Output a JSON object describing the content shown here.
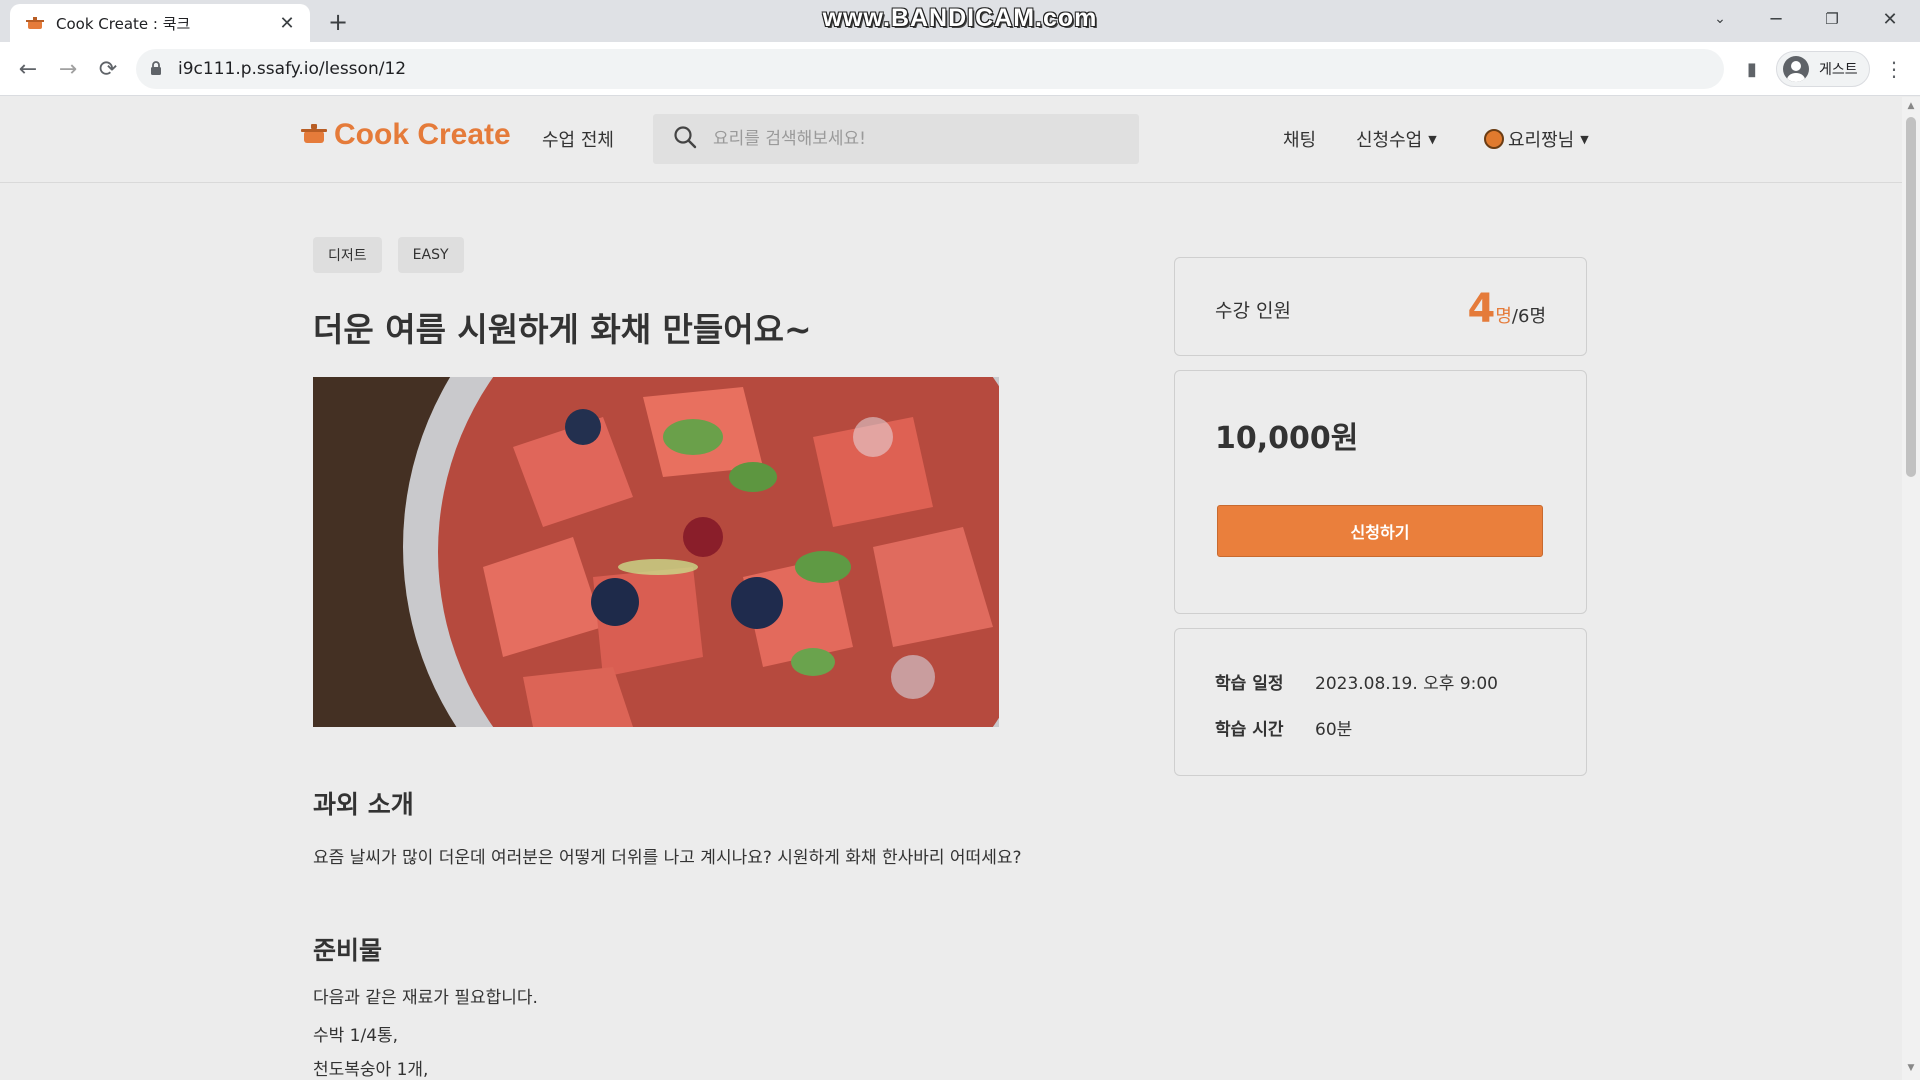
{
  "browser": {
    "tab_title": "Cook Create : 쿡크",
    "watermark": "www.BANDICAM.com",
    "url": "i9c111.p.ssafy.io/lesson/12",
    "profile_label": "게스트"
  },
  "header": {
    "logo": "Cook Create",
    "nav_all": "수업 전체",
    "search_placeholder": "요리를 검색해보세요!",
    "nav_chat": "채팅",
    "nav_apply": "신청수업",
    "nav_user": "요리짱님"
  },
  "lesson": {
    "tags": [
      "디저트",
      "EASY"
    ],
    "title": "더운 여름 시원하게 화채 만들어요~",
    "intro_heading": "과외 소개",
    "intro_text": "요즘 날씨가 많이 더운데 여러분은 어떻게 더위를 나고 계시나요? 시원하게 화채 한사바리 어떠세요?",
    "prep_heading": "준비물",
    "prep_lines": [
      "다음과 같은 재료가 필요합니다.",
      "수박 1/4통,",
      "천도복숭아 1개,"
    ]
  },
  "sidebar": {
    "enroll_label": "수강 인원",
    "enroll_current": "4",
    "enroll_unit": "명",
    "enroll_max": "/6명",
    "price": "10,000원",
    "apply_button": "신청하기",
    "schedule_label": "학습 일정",
    "schedule_value": "2023.08.19. 오후 9:00",
    "duration_label": "학습 시간",
    "duration_value": "60분"
  },
  "colors": {
    "accent": "#ea7f3c",
    "background": "#ececec"
  }
}
